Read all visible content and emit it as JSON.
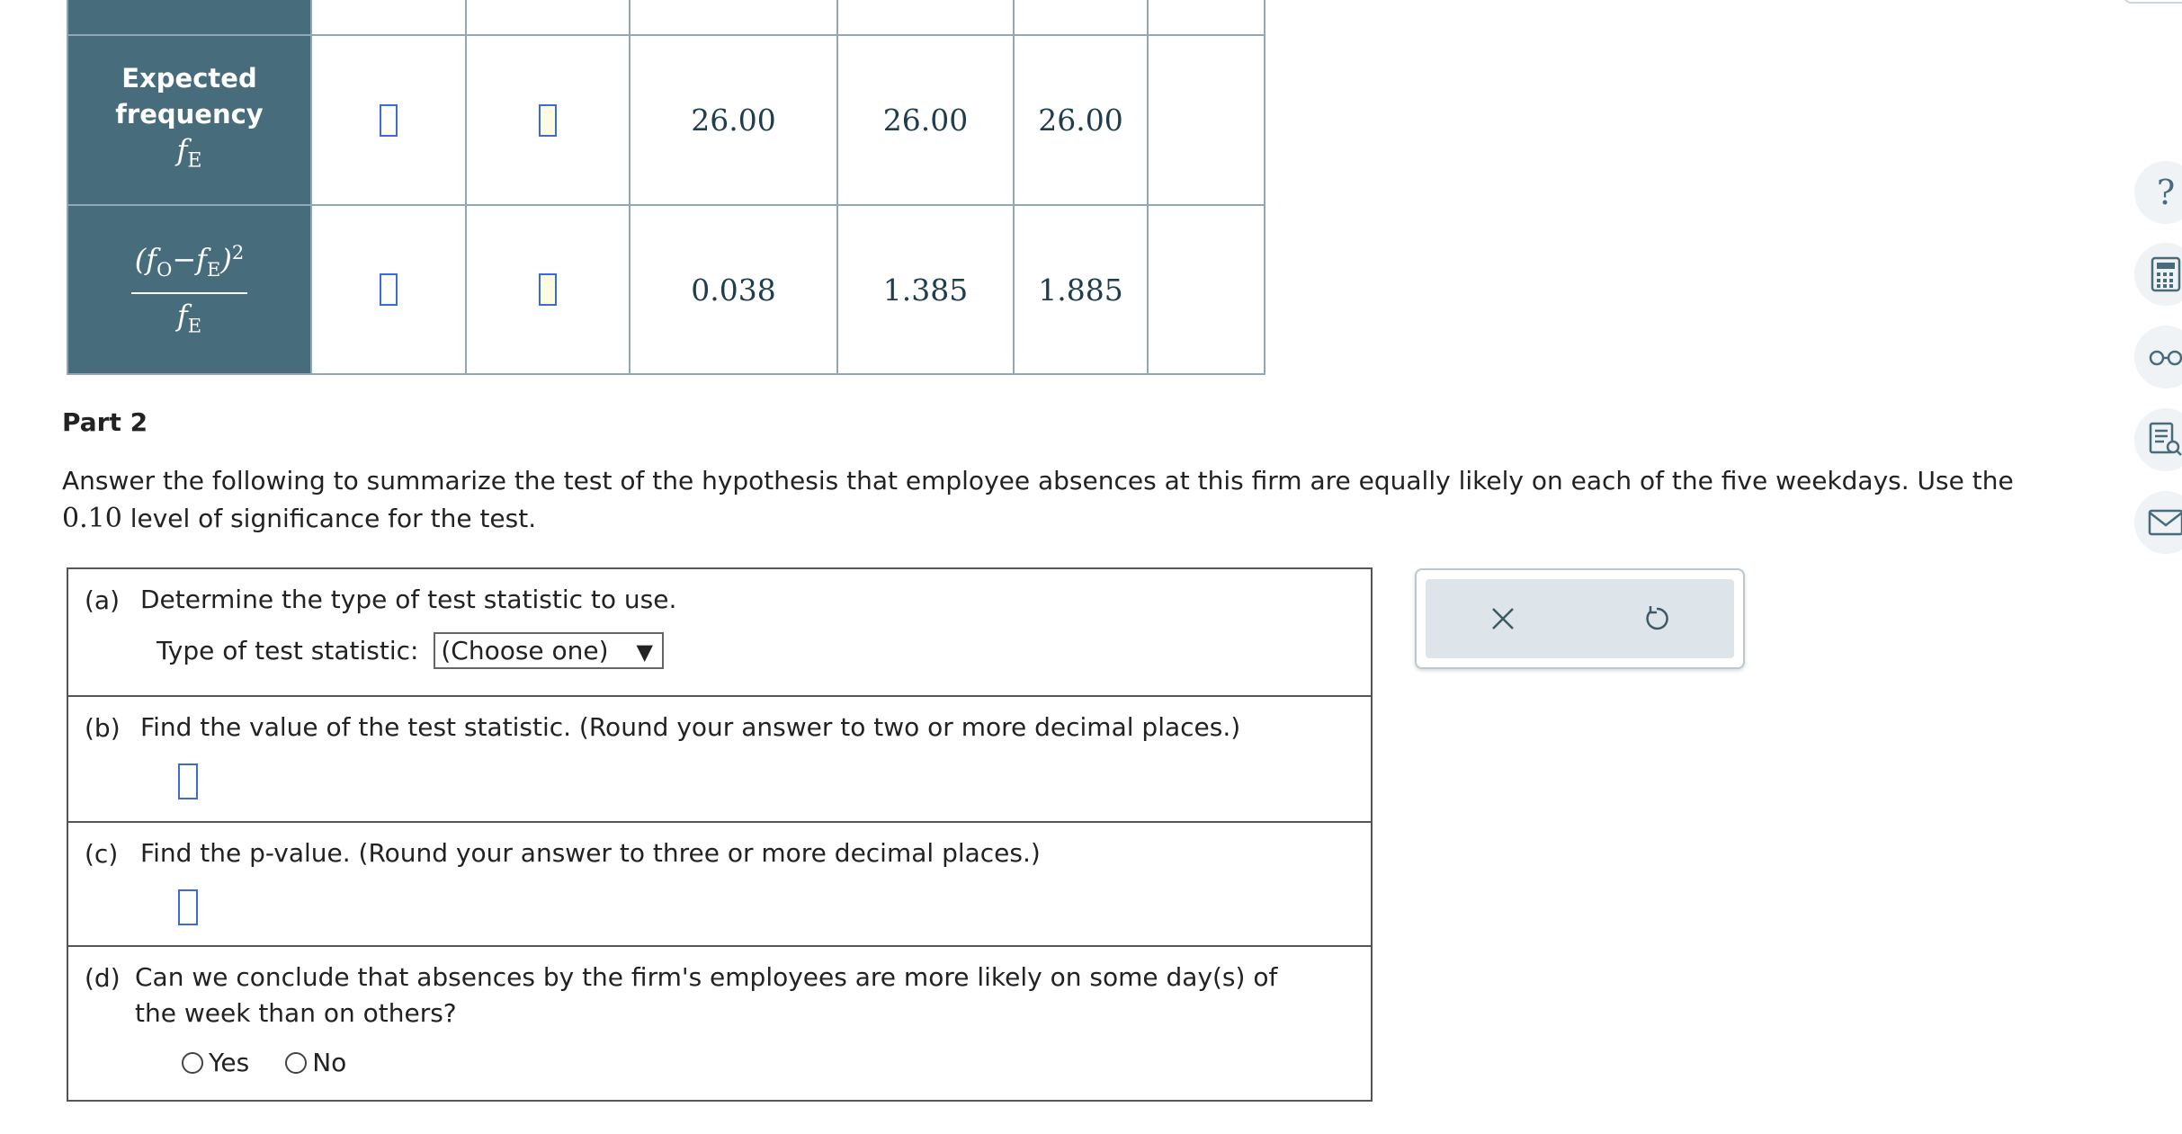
{
  "table": {
    "rows": [
      {
        "header_line1": "Expected",
        "header_line2": "frequency",
        "header_symbol": "f",
        "header_symbol_sub": "E",
        "cells": [
          "",
          "",
          "26.00",
          "26.00",
          "26.00",
          ""
        ]
      },
      {
        "header_num_f1": "f",
        "header_num_sub1": "O",
        "header_num_minus": "−",
        "header_num_f2": "f",
        "header_num_sub2": "E",
        "header_num_sup": "2",
        "header_den_f": "f",
        "header_den_sub": "E",
        "cells": [
          "",
          "",
          "0.038",
          "1.385",
          "1.885",
          ""
        ]
      }
    ]
  },
  "part": {
    "title": "Part 2",
    "instruction_text": "Answer the following to summarize the test of the hypothesis that employee absences at this firm are equally likely on each of the five weekdays. Use the",
    "significance": "0.10",
    "instruction_tail": "level of significance for the test."
  },
  "questions": {
    "a": {
      "label": "(a)",
      "text": "Determine the type of test statistic to use.",
      "field_label": "Type of test statistic:",
      "select_value": "(Choose one)",
      "select_arrow": "▼"
    },
    "b": {
      "label": "(b)",
      "text": "Find the value of the test statistic. (Round your answer to two or more decimal places.)"
    },
    "c": {
      "label": "(c)",
      "text": "Find the p-value. (Round your answer to three or more decimal places.)"
    },
    "d": {
      "label": "(d)",
      "text": "Can we conclude that absences by the firm's employees are more likely on some day(s) of the week than on others?",
      "options": [
        "Yes",
        "No"
      ]
    }
  },
  "actions": {
    "clear_icon": "close-icon",
    "undo_icon": "undo-icon"
  },
  "tools": {
    "help_label": "?",
    "icons": [
      "help-icon",
      "calculator-icon",
      "glasses-icon",
      "data-icon",
      "mail-icon"
    ]
  },
  "colors": {
    "header_bg": "#476c7c",
    "table_border": "#8fa7b6",
    "input_border": "#3a6bd6",
    "action_bg": "#dde5ea"
  }
}
